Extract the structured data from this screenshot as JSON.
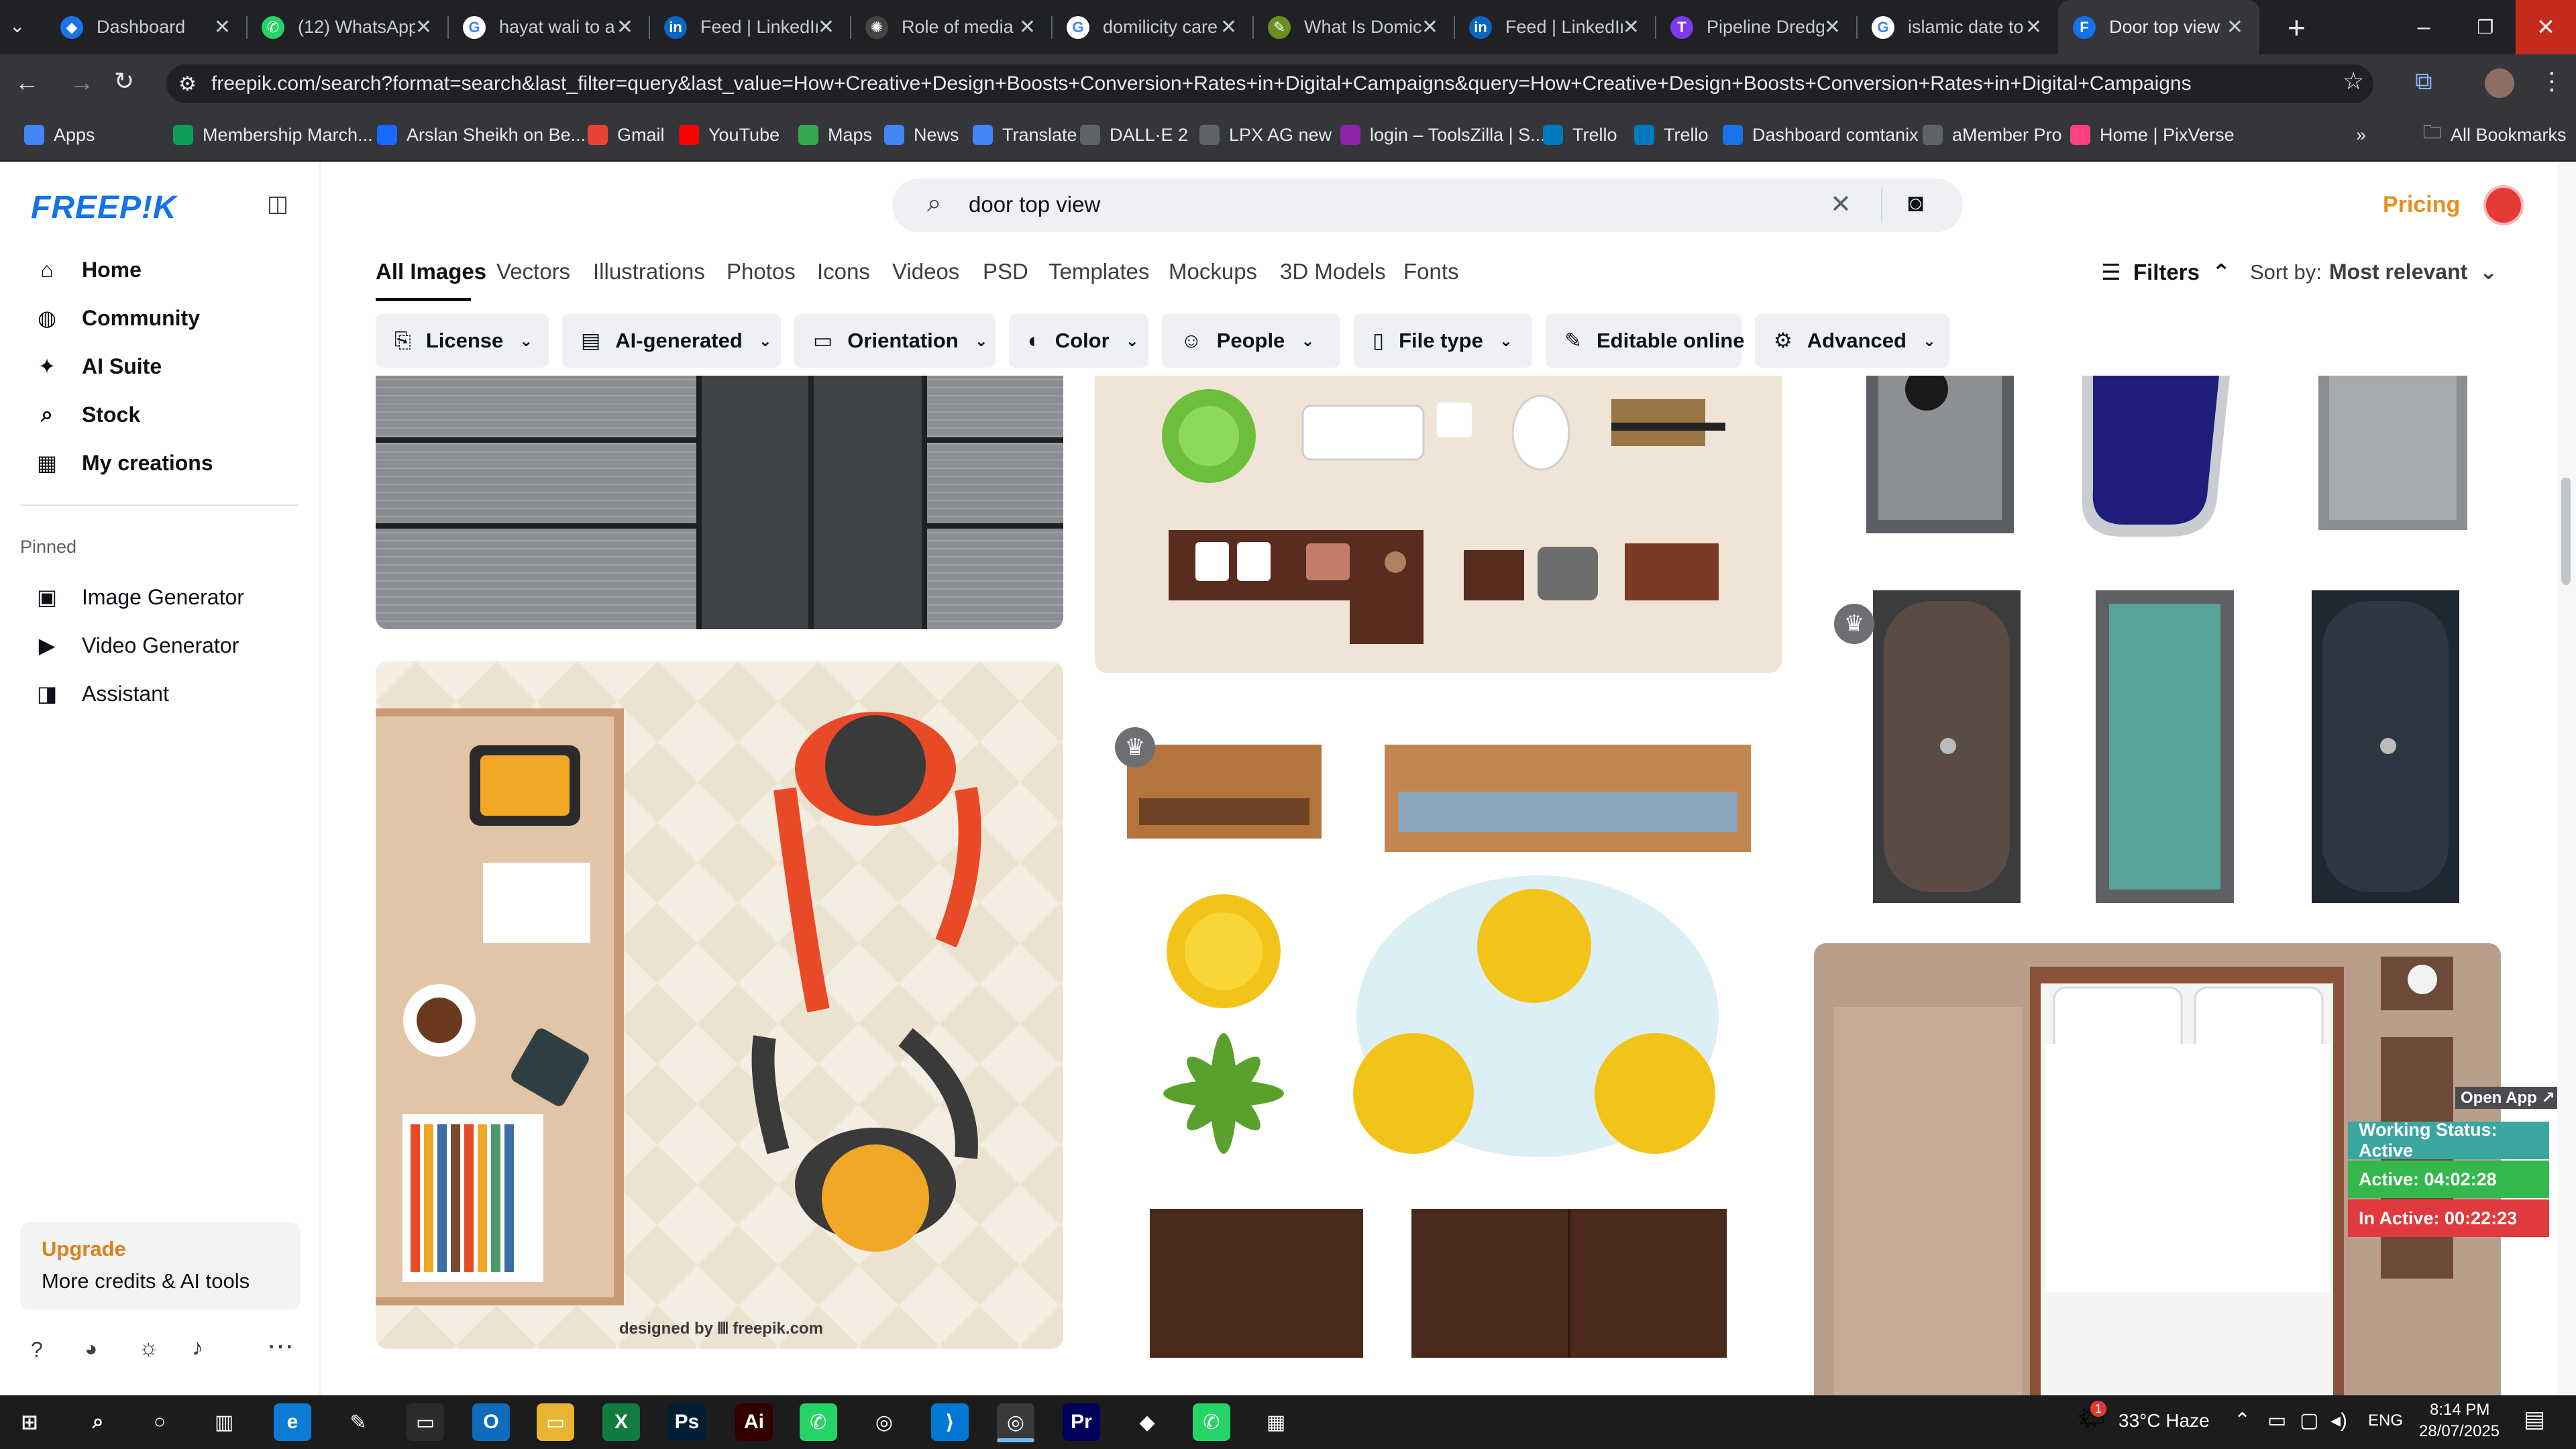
{
  "browser": {
    "tabs": [
      {
        "title": "Dashboard",
        "icon": "dashboard-icon",
        "color": "#1a73e8",
        "glyph": "◆"
      },
      {
        "title": "(12) WhatsApp",
        "icon": "whatsapp-icon",
        "color": "#25d366",
        "glyph": "✆"
      },
      {
        "title": "hayat wali to a",
        "icon": "google-icon",
        "color": "#ffffff",
        "glyph": "G"
      },
      {
        "title": "Feed | LinkedIn",
        "icon": "linkedin-icon",
        "color": "#0a66c2",
        "glyph": "in"
      },
      {
        "title": "Role of media",
        "icon": "openai-icon",
        "color": "#444444",
        "glyph": "✺"
      },
      {
        "title": "domilicity care",
        "icon": "google-icon",
        "color": "#ffffff",
        "glyph": "G"
      },
      {
        "title": "What Is Domic",
        "icon": "leaf-icon",
        "color": "#6b8e23",
        "glyph": "✎"
      },
      {
        "title": "Feed | LinkedIn",
        "icon": "linkedin-icon",
        "color": "#0a66c2",
        "glyph": "in"
      },
      {
        "title": "Pipeline Dredg",
        "icon": "t-icon",
        "color": "#7c3aed",
        "glyph": "T"
      },
      {
        "title": "islamic date to",
        "icon": "google-icon",
        "color": "#ffffff",
        "glyph": "G"
      },
      {
        "title": "Door top view",
        "icon": "freepik-icon",
        "color": "#1273eb",
        "glyph": "F"
      }
    ],
    "url": "freepik.com/search?format=search&last_filter=query&last_value=How+Creative+Design+Boosts+Conversion+Rates+in+Digital+Campaigns&query=How+Creative+Design+Boosts+Conversion+Rates+in+Digital+Campaigns",
    "bookmarks": [
      {
        "label": "Apps",
        "color": "#4285f4"
      },
      {
        "label": "Membership March...",
        "color": "#0f9d58"
      },
      {
        "label": "Arslan Sheikh on Be...",
        "color": "#1769ff"
      },
      {
        "label": "Gmail",
        "color": "#ea4335"
      },
      {
        "label": "YouTube",
        "color": "#ff0000"
      },
      {
        "label": "Maps",
        "color": "#34a853"
      },
      {
        "label": "News",
        "color": "#4285f4"
      },
      {
        "label": "Translate",
        "color": "#4285f4"
      },
      {
        "label": "DALL·E 2",
        "color": "#5f6368"
      },
      {
        "label": "LPX AG new",
        "color": "#5f6368"
      },
      {
        "label": "login – ToolsZilla | S...",
        "color": "#8e24aa"
      },
      {
        "label": "Trello",
        "color": "#0079bf"
      },
      {
        "label": "Trello",
        "color": "#0079bf"
      },
      {
        "label": "Dashboard comtanix",
        "color": "#1a73e8"
      },
      {
        "label": "aMember Pro",
        "color": "#5f6368"
      },
      {
        "label": "Home | PixVerse",
        "color": "#ff4081"
      }
    ],
    "all_bookmarks": "All Bookmarks"
  },
  "sidebar": {
    "logo": "FREEP!K",
    "main": [
      {
        "label": "Home",
        "icon": "home-icon",
        "glyph": "⌂"
      },
      {
        "label": "Community",
        "icon": "globe-icon",
        "glyph": "◍"
      },
      {
        "label": "AI Suite",
        "icon": "sparkle-icon",
        "glyph": "✦"
      },
      {
        "label": "Stock",
        "icon": "search-icon",
        "glyph": "⌕"
      },
      {
        "label": "My creations",
        "icon": "grid-icon",
        "glyph": "▦"
      }
    ],
    "pinned_title": "Pinned",
    "pinned": [
      {
        "label": "Image Generator",
        "icon": "image-icon",
        "glyph": "▣"
      },
      {
        "label": "Video Generator",
        "icon": "video-icon",
        "glyph": "▶"
      },
      {
        "label": "Assistant",
        "icon": "chat-icon",
        "glyph": "◨"
      }
    ],
    "upgrade_title": "Upgrade",
    "upgrade_sub": "More credits & AI tools"
  },
  "header": {
    "search_value": "door top view",
    "pricing": "Pricing"
  },
  "type_tabs": [
    "All Images",
    "Vectors",
    "Illustrations",
    "Photos",
    "Icons",
    "Videos",
    "PSD",
    "Templates",
    "Mockups",
    "3D Models",
    "Fonts"
  ],
  "filters_label": "Filters",
  "sort_label": "Sort by:",
  "sort_value": "Most relevant",
  "filter_chips": [
    {
      "label": "License",
      "glyph": "⎘"
    },
    {
      "label": "AI-generated",
      "glyph": "▤"
    },
    {
      "label": "Orientation",
      "glyph": "▭"
    },
    {
      "label": "Color",
      "glyph": "◐"
    },
    {
      "label": "People",
      "glyph": "☺"
    },
    {
      "label": "File type",
      "glyph": "▯"
    },
    {
      "label": "Editable online",
      "glyph": "✎"
    },
    {
      "label": "Advanced",
      "glyph": "⚙"
    }
  ],
  "tile_caption": "designed by 𝍬 freepik.com",
  "status_widget": {
    "open_app": "Open App ↗",
    "working": "Working Status: Active",
    "active": "Active: 04:02:28",
    "inactive": "In Active: 00:22:23",
    "colors": {
      "working": "#3aa6a0",
      "active": "#35b84b",
      "inactive": "#e0393e"
    }
  },
  "taskbar": {
    "weather": "33°C  Haze",
    "lang": "ENG",
    "time": "8:14 PM",
    "date": "28/07/2025",
    "badge": "1"
  }
}
